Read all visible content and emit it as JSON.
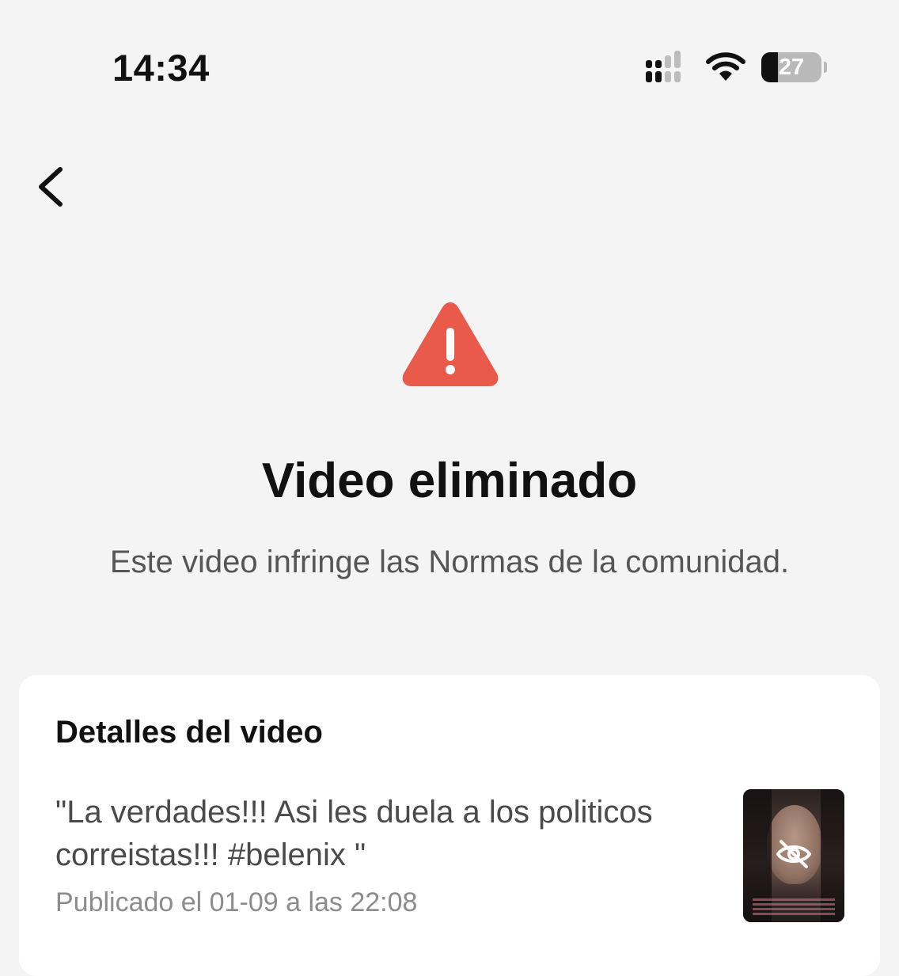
{
  "status_bar": {
    "time": "14:34",
    "battery_level": "27",
    "battery_fraction": 0.27,
    "signal_icon": "cellular-signal-icon",
    "wifi_icon": "wifi-icon"
  },
  "nav": {
    "back_icon": "chevron-left-icon"
  },
  "notice": {
    "icon": "warning-triangle-icon",
    "icon_color": "#ea5a4b",
    "title": "Video eliminado",
    "subtitle": "Este video infringe las Normas de la comunidad."
  },
  "details": {
    "heading": "Detalles del video",
    "caption": "\"La verdades!!! Asi les duela a los politicos correistas!!! #belenix \"",
    "published": "Publicado el 01-09 a las 22:08",
    "thumbnail_icon": "eye-slash-icon"
  }
}
